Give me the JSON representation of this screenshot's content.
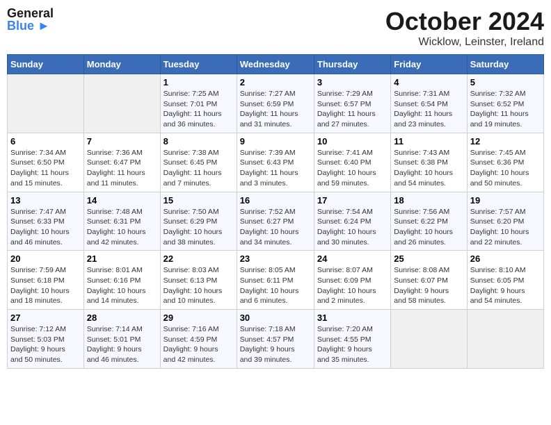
{
  "header": {
    "logo_text_general": "General",
    "logo_text_blue": "Blue",
    "month_title": "October 2024",
    "location": "Wicklow, Leinster, Ireland"
  },
  "calendar": {
    "days_of_week": [
      "Sunday",
      "Monday",
      "Tuesday",
      "Wednesday",
      "Thursday",
      "Friday",
      "Saturday"
    ],
    "weeks": [
      [
        {
          "day": "",
          "detail": ""
        },
        {
          "day": "",
          "detail": ""
        },
        {
          "day": "1",
          "detail": "Sunrise: 7:25 AM\nSunset: 7:01 PM\nDaylight: 11 hours\nand 36 minutes."
        },
        {
          "day": "2",
          "detail": "Sunrise: 7:27 AM\nSunset: 6:59 PM\nDaylight: 11 hours\nand 31 minutes."
        },
        {
          "day": "3",
          "detail": "Sunrise: 7:29 AM\nSunset: 6:57 PM\nDaylight: 11 hours\nand 27 minutes."
        },
        {
          "day": "4",
          "detail": "Sunrise: 7:31 AM\nSunset: 6:54 PM\nDaylight: 11 hours\nand 23 minutes."
        },
        {
          "day": "5",
          "detail": "Sunrise: 7:32 AM\nSunset: 6:52 PM\nDaylight: 11 hours\nand 19 minutes."
        }
      ],
      [
        {
          "day": "6",
          "detail": "Sunrise: 7:34 AM\nSunset: 6:50 PM\nDaylight: 11 hours\nand 15 minutes."
        },
        {
          "day": "7",
          "detail": "Sunrise: 7:36 AM\nSunset: 6:47 PM\nDaylight: 11 hours\nand 11 minutes."
        },
        {
          "day": "8",
          "detail": "Sunrise: 7:38 AM\nSunset: 6:45 PM\nDaylight: 11 hours\nand 7 minutes."
        },
        {
          "day": "9",
          "detail": "Sunrise: 7:39 AM\nSunset: 6:43 PM\nDaylight: 11 hours\nand 3 minutes."
        },
        {
          "day": "10",
          "detail": "Sunrise: 7:41 AM\nSunset: 6:40 PM\nDaylight: 10 hours\nand 59 minutes."
        },
        {
          "day": "11",
          "detail": "Sunrise: 7:43 AM\nSunset: 6:38 PM\nDaylight: 10 hours\nand 54 minutes."
        },
        {
          "day": "12",
          "detail": "Sunrise: 7:45 AM\nSunset: 6:36 PM\nDaylight: 10 hours\nand 50 minutes."
        }
      ],
      [
        {
          "day": "13",
          "detail": "Sunrise: 7:47 AM\nSunset: 6:33 PM\nDaylight: 10 hours\nand 46 minutes."
        },
        {
          "day": "14",
          "detail": "Sunrise: 7:48 AM\nSunset: 6:31 PM\nDaylight: 10 hours\nand 42 minutes."
        },
        {
          "day": "15",
          "detail": "Sunrise: 7:50 AM\nSunset: 6:29 PM\nDaylight: 10 hours\nand 38 minutes."
        },
        {
          "day": "16",
          "detail": "Sunrise: 7:52 AM\nSunset: 6:27 PM\nDaylight: 10 hours\nand 34 minutes."
        },
        {
          "day": "17",
          "detail": "Sunrise: 7:54 AM\nSunset: 6:24 PM\nDaylight: 10 hours\nand 30 minutes."
        },
        {
          "day": "18",
          "detail": "Sunrise: 7:56 AM\nSunset: 6:22 PM\nDaylight: 10 hours\nand 26 minutes."
        },
        {
          "day": "19",
          "detail": "Sunrise: 7:57 AM\nSunset: 6:20 PM\nDaylight: 10 hours\nand 22 minutes."
        }
      ],
      [
        {
          "day": "20",
          "detail": "Sunrise: 7:59 AM\nSunset: 6:18 PM\nDaylight: 10 hours\nand 18 minutes."
        },
        {
          "day": "21",
          "detail": "Sunrise: 8:01 AM\nSunset: 6:16 PM\nDaylight: 10 hours\nand 14 minutes."
        },
        {
          "day": "22",
          "detail": "Sunrise: 8:03 AM\nSunset: 6:13 PM\nDaylight: 10 hours\nand 10 minutes."
        },
        {
          "day": "23",
          "detail": "Sunrise: 8:05 AM\nSunset: 6:11 PM\nDaylight: 10 hours\nand 6 minutes."
        },
        {
          "day": "24",
          "detail": "Sunrise: 8:07 AM\nSunset: 6:09 PM\nDaylight: 10 hours\nand 2 minutes."
        },
        {
          "day": "25",
          "detail": "Sunrise: 8:08 AM\nSunset: 6:07 PM\nDaylight: 9 hours\nand 58 minutes."
        },
        {
          "day": "26",
          "detail": "Sunrise: 8:10 AM\nSunset: 6:05 PM\nDaylight: 9 hours\nand 54 minutes."
        }
      ],
      [
        {
          "day": "27",
          "detail": "Sunrise: 7:12 AM\nSunset: 5:03 PM\nDaylight: 9 hours\nand 50 minutes."
        },
        {
          "day": "28",
          "detail": "Sunrise: 7:14 AM\nSunset: 5:01 PM\nDaylight: 9 hours\nand 46 minutes."
        },
        {
          "day": "29",
          "detail": "Sunrise: 7:16 AM\nSunset: 4:59 PM\nDaylight: 9 hours\nand 42 minutes."
        },
        {
          "day": "30",
          "detail": "Sunrise: 7:18 AM\nSunset: 4:57 PM\nDaylight: 9 hours\nand 39 minutes."
        },
        {
          "day": "31",
          "detail": "Sunrise: 7:20 AM\nSunset: 4:55 PM\nDaylight: 9 hours\nand 35 minutes."
        },
        {
          "day": "",
          "detail": ""
        },
        {
          "day": "",
          "detail": ""
        }
      ]
    ]
  }
}
